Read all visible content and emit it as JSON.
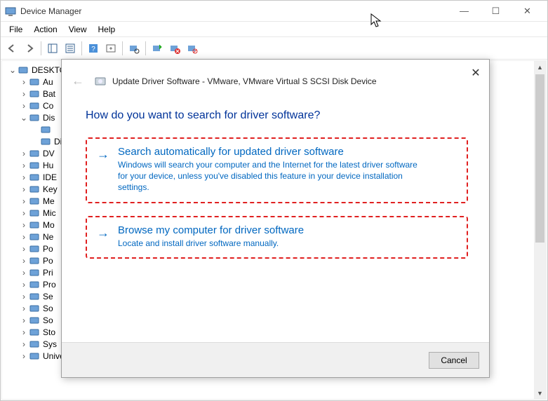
{
  "title": "Device Manager",
  "window_controls": {
    "min": "—",
    "max": "☐",
    "close": "✕"
  },
  "menu": {
    "file": "File",
    "action": "Action",
    "view": "View",
    "help": "Help"
  },
  "tree": {
    "root": "DESKTO",
    "items": [
      {
        "label": "Au",
        "exp": "›"
      },
      {
        "label": "Bat",
        "exp": "›"
      },
      {
        "label": "Co",
        "exp": "›"
      },
      {
        "label": "Dis",
        "exp": "⌄",
        "children": [
          {
            "label": ""
          },
          {
            "label": "Dis"
          }
        ]
      },
      {
        "label": "DV",
        "exp": "›"
      },
      {
        "label": "Hu",
        "exp": "›"
      },
      {
        "label": "IDE",
        "exp": "›"
      },
      {
        "label": "Key",
        "exp": "›"
      },
      {
        "label": "Me",
        "exp": "›"
      },
      {
        "label": "Mic",
        "exp": "›"
      },
      {
        "label": "Mo",
        "exp": "›"
      },
      {
        "label": "Ne",
        "exp": "›"
      },
      {
        "label": "Po",
        "exp": "›"
      },
      {
        "label": "Po",
        "exp": "›"
      },
      {
        "label": "Pri",
        "exp": "›"
      },
      {
        "label": "Pro",
        "exp": "›"
      },
      {
        "label": "Se",
        "exp": "›"
      },
      {
        "label": "So",
        "exp": "›"
      },
      {
        "label": "So",
        "exp": "›"
      },
      {
        "label": "Sto",
        "exp": "›"
      },
      {
        "label": "Sys",
        "exp": "›"
      },
      {
        "label": "Universal Serial Bus controllers",
        "exp": "›"
      }
    ]
  },
  "dialog": {
    "title": "Update Driver Software - VMware, VMware Virtual S SCSI Disk Device",
    "heading": "How do you want to search for driver software?",
    "opt1": {
      "title": "Search automatically for updated driver software",
      "desc": "Windows will search your computer and the Internet for the latest driver software for your device, unless you've disabled this feature in your device installation settings."
    },
    "opt2": {
      "title": "Browse my computer for driver software",
      "desc": "Locate and install driver software manually."
    },
    "cancel": "Cancel"
  }
}
